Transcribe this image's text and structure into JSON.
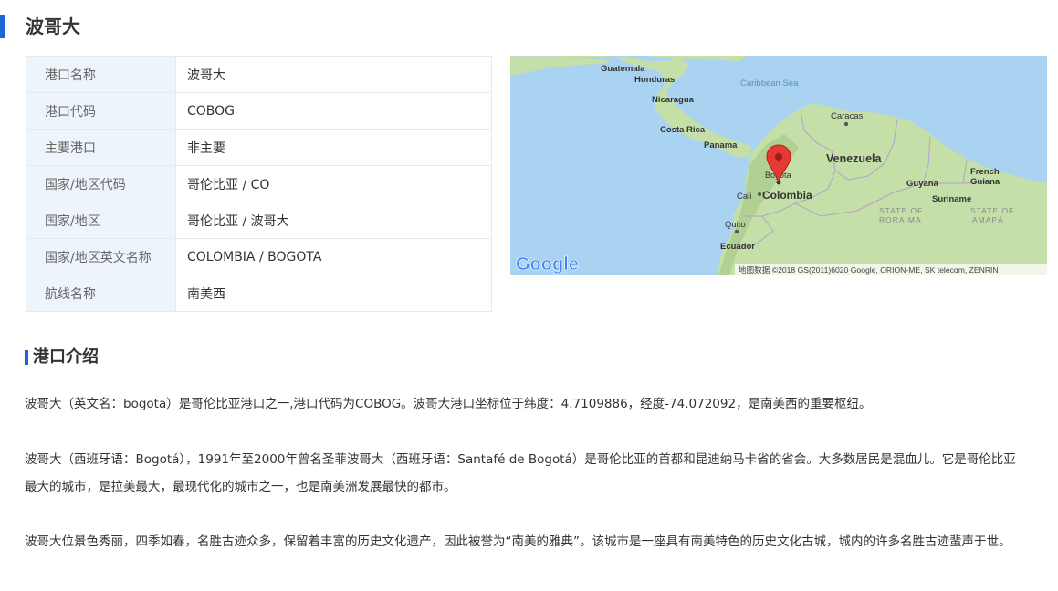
{
  "page_title": "波哥大",
  "info_rows": [
    {
      "key": "港口名称",
      "value": "波哥大"
    },
    {
      "key": "港口代码",
      "value": "COBOG"
    },
    {
      "key": "主要港口",
      "value": "非主要"
    },
    {
      "key": "国家/地区代码",
      "value": "哥伦比亚 / CO"
    },
    {
      "key": "国家/地区",
      "value": "哥伦比亚 / 波哥大"
    },
    {
      "key": "国家/地区英文名称",
      "value": "COLOMBIA / BOGOTA"
    },
    {
      "key": "航线名称",
      "value": "南美西"
    }
  ],
  "map": {
    "labels": {
      "guatemala": "Guatemala",
      "honduras": "Honduras",
      "caribbean": "Caribbean Sea",
      "nicaragua": "Nicaragua",
      "costa_rica": "Costa Rica",
      "panama": "Panama",
      "caracas": "Caracas",
      "venezuela": "Venezuela",
      "bogota": "Bogota",
      "cali": "Cali",
      "colombia": "Colombia",
      "guyana": "Guyana",
      "french_guiana_1": "French",
      "french_guiana_2": "Guiana",
      "suriname": "Suriname",
      "roraima_1": "STATE OF",
      "roraima_2": "RORAIMA",
      "amapa_1": "STATE OF",
      "amapa_2": "AMAPÁ",
      "quito": "Quito",
      "ecuador": "Ecuador"
    },
    "logo": "Google",
    "attribution": "地图数据 ©2018 GS(2011)6020 Google, ORION-ME, SK telecom, ZENRIN",
    "colors": {
      "water": "#aad3f2",
      "land": "#c4dfa8",
      "pin": "#e53935"
    }
  },
  "section_title": "港口介绍",
  "paragraphs": [
    "波哥大（英文名：bogota）是哥伦比亚港口之一,港口代码为COBOG。波哥大港口坐标位于纬度：4.7109886，经度-74.072092，是南美西的重要枢纽。",
    "波哥大（西班牙语：Bogotá），1991年至2000年曾名圣菲波哥大（西班牙语：Santafé de Bogotá）是哥伦比亚的首都和昆迪纳马卡省的省会。大多数居民是混血儿。它是哥伦比亚最大的城市，是拉美最大，最现代化的城市之一，也是南美洲发展最快的都市。",
    "波哥大位景色秀丽，四季如春，名胜古迹众多，保留着丰富的历史文化遗产，因此被誉为“南美的雅典”。该城市是一座具有南美特色的历史文化古城，城内的许多名胜古迹蜚声于世。"
  ]
}
